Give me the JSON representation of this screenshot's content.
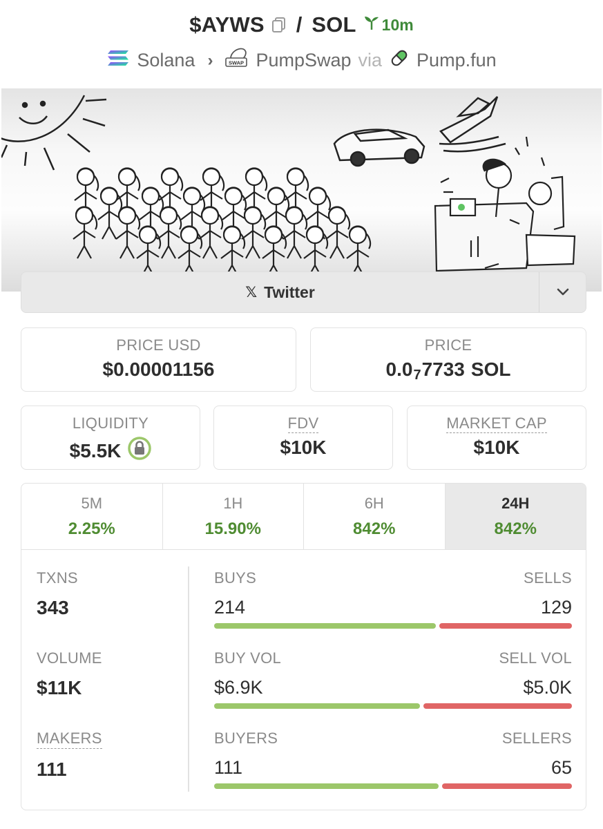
{
  "header": {
    "symbol": "$AYWS",
    "separator": "/",
    "quote": "SOL",
    "age": "10m",
    "chain": "Solana",
    "dex": "PumpSwap",
    "dex_icon_text": "SWAP",
    "via": "via",
    "launchpad": "Pump.fun"
  },
  "social": {
    "twitter_label": "Twitter",
    "x_glyph": "𝕏"
  },
  "price": {
    "usd_label": "PRICE USD",
    "usd_value": "$0.00001156",
    "native_label": "PRICE",
    "native_prefix": "0.0",
    "native_zeros": "7",
    "native_digits": "7733",
    "native_unit": "SOL"
  },
  "metrics": {
    "liquidity_label": "LIQUIDITY",
    "liquidity_value": "$5.5K",
    "fdv_label": "FDV",
    "fdv_value": "$10K",
    "mcap_label": "MARKET CAP",
    "mcap_value": "$10K"
  },
  "tabs": [
    {
      "label": "5M",
      "value": "2.25%"
    },
    {
      "label": "1H",
      "value": "15.90%"
    },
    {
      "label": "6H",
      "value": "842%"
    },
    {
      "label": "24H",
      "value": "842%"
    }
  ],
  "active_tab": "24H",
  "stats": {
    "txns_label": "TXNS",
    "txns_value": "343",
    "volume_label": "VOLUME",
    "volume_value": "$11K",
    "makers_label": "MAKERS",
    "makers_value": "111",
    "buys_label": "BUYS",
    "buys_value": "214",
    "sells_label": "SELLS",
    "sells_value": "129",
    "buy_vol_label": "BUY VOL",
    "buy_vol_value": "$6.9K",
    "sell_vol_label": "SELL VOL",
    "sell_vol_value": "$5.0K",
    "buyers_label": "BUYERS",
    "buyers_value": "111",
    "sellers_label": "SELLERS",
    "sellers_value": "65"
  },
  "ratios": {
    "txns_buy_fraction": 0.624,
    "vol_buy_fraction": 0.58,
    "makers_buy_fraction": 0.631
  },
  "colors": {
    "positive": "#4f8c32",
    "buy_bar": "#9cc76a",
    "sell_bar": "#e06565",
    "age_green": "#3f8a3a"
  },
  "icons": [
    "copy-icon",
    "sprout-icon",
    "solana-icon",
    "pumpswap-icon",
    "pill-icon",
    "x-icon",
    "chevron-down-icon",
    "lock-icon"
  ]
}
